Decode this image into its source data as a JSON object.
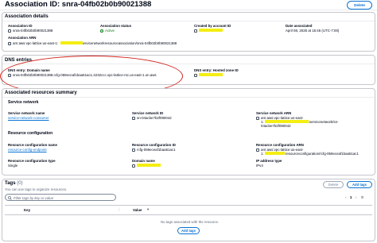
{
  "page": {
    "title": "Association ID: snra-04fb02b0b90021388",
    "delete_label": "Delete"
  },
  "details": {
    "header": "Association details",
    "association_id_label": "Association ID",
    "association_id_value": "snra-04fb02b0b90021388",
    "association_arn_label": "Association ARN",
    "association_arn_value": "arn:aws:vpc-lattice:us-east-1:",
    "association_arn_suffix": ":servicenetworkresourceassociation/snra-04fb02b0b90021388",
    "status_label": "Association status",
    "status_value": "Active",
    "created_by_label": "Created by account ID",
    "date_label": "Date associated",
    "date_value": "April 08, 2025 at 15:46 (UTC-7:00)"
  },
  "dns": {
    "header": "DNS entries",
    "domain_label": "DNS entry: Domain name",
    "domain_value": "snra-04fb02b0b90021388.rcfg-059eceaf1baa51ac1.4232ccc.vpc-lattice-rsc.us-east-1.on.aws",
    "hosted_zone_label": "DNS entry: Hosted zone ID"
  },
  "resources": {
    "header": "Associated resources summary",
    "service_network_subheader": "Service network",
    "sn_name_label": "Service network name",
    "sn_name_value": "service-network-consumer",
    "sn_id_label": "Service network ID",
    "sn_id_value": "sn-04acbe7b2f090042",
    "sn_arn_label": "Service network ARN",
    "sn_arn_value": "arn:aws:vpc-lattice:us-east-",
    "sn_arn_line2_prefix": "1:",
    "sn_arn_line2_suffix": ":servicenetwork/sn-",
    "sn_arn_line3": "04acbe7b2f090042",
    "rc_subheader": "Resource configuration",
    "rc_name_label": "Resource configuration name",
    "rc_name_value": "resource-config-endpoint",
    "rc_id_label": "Resource configuration ID",
    "rc_id_value": "rcfg-059eceaf1baa51ac1",
    "rc_arn_label": "Resource configuration ARN",
    "rc_arn_value": "arn:aws:vpc-lattice:us-east-",
    "rc_arn_line2_prefix": "1:",
    "rc_arn_line2_suffix": ":resourceconfiguration/rcfg-059eceaf1baa51ac1",
    "rc_type_label": "Resource configuration type",
    "rc_type_value": "Single",
    "domain_name_label": "Domain name",
    "ip_type_label": "IP address type",
    "ip_type_value": "IPv4"
  },
  "tags": {
    "header": "Tags",
    "count": "(0)",
    "description": "You can use tags to organize resources.",
    "delete_label": "Delete",
    "add_label": "Add tags",
    "search_placeholder": "Filter tags by key or value",
    "page_number": "1",
    "col_key": "Key",
    "col_value": "Value",
    "empty_text": "No tags associated with the resource.",
    "add_bottom_label": "Add tags"
  },
  "colors": {
    "accent": "#0972d3",
    "highlight": "#f4ee13",
    "annotation": "#d0261f",
    "status_active": "#037f0c"
  }
}
